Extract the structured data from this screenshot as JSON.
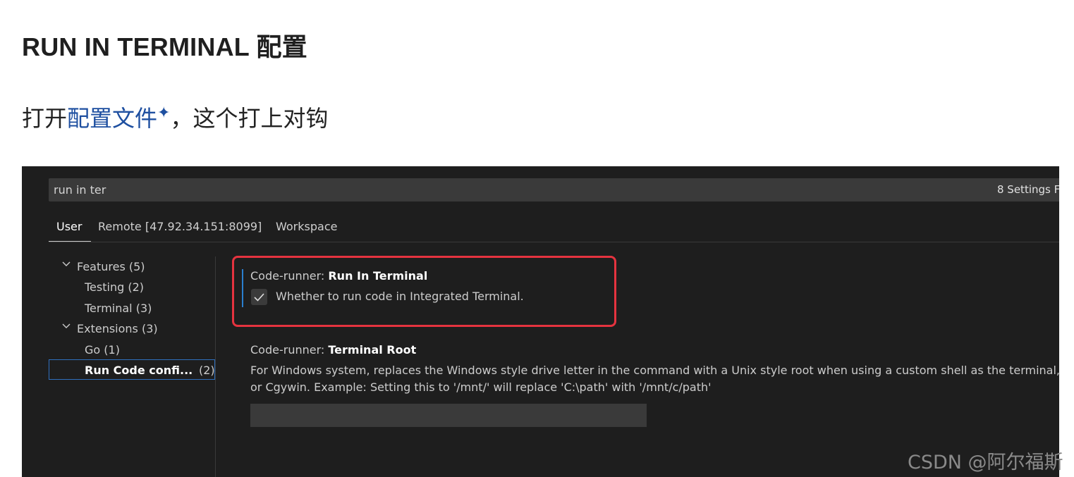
{
  "article": {
    "heading": "RUN IN TERMINAL 配置",
    "para_prefix": "打开",
    "para_link": "配置文件",
    "para_suffix": "，这个打上对钩"
  },
  "settings": {
    "search": {
      "value": "run in ter",
      "results": "8 Settings F"
    },
    "tabs": [
      {
        "label": "User",
        "active": true
      },
      {
        "label": "Remote [47.92.34.151:8099]",
        "active": false
      },
      {
        "label": "Workspace",
        "active": false
      }
    ],
    "tree": {
      "features": "Features (5)",
      "testing": "Testing (2)",
      "terminal": "Terminal (3)",
      "extensions": "Extensions (3)",
      "go": "Go (1)",
      "runcode_label": "Run Code confi...",
      "runcode_count": "(2)"
    },
    "run_in_terminal": {
      "prefix": "Code-runner: ",
      "name": "Run In Terminal",
      "description": "Whether to run code in Integrated Terminal.",
      "checked": true
    },
    "terminal_root": {
      "prefix": "Code-runner: ",
      "name": "Terminal Root",
      "description_line1": "For Windows system, replaces the Windows style drive letter in the command with a Unix style root when using a custom shell as the terminal,",
      "description_line2": "or Cgywin. Example: Setting this to '/mnt/' will replace 'C:\\path' with '/mnt/c/path'",
      "value": ""
    }
  },
  "watermark": "CSDN @阿尔福斯",
  "colors": {
    "highlight": "#e5333f",
    "link": "#1e4fa0",
    "editor_bg": "#1e1e1e",
    "focus": "#2a7fcf"
  }
}
